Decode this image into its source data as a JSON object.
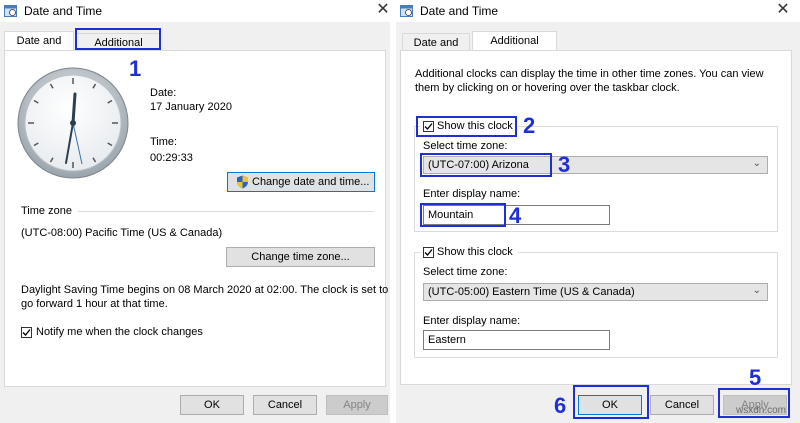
{
  "left_window": {
    "title": "Date and Time",
    "tabs": [
      {
        "label": "Date and Time"
      },
      {
        "label": "Additional Clocks"
      }
    ],
    "date_label": "Date:",
    "date_value": "17 January 2020",
    "time_label": "Time:",
    "time_value": "00:29:33",
    "change_datetime_button": "Change date and time...",
    "timezone_section": "Time zone",
    "timezone_value": "(UTC-08:00) Pacific Time (US & Canada)",
    "change_timezone_button": "Change time zone...",
    "dst_text_line1": "Daylight Saving Time begins on 08 March 2020 at 02:00. The clock is set to",
    "dst_text_line2": "go forward 1 hour at that time.",
    "notify_checkbox_label": "Notify me when the clock changes",
    "notify_checked": true,
    "ok_button": "OK",
    "cancel_button": "Cancel",
    "apply_button": "Apply"
  },
  "right_window": {
    "title": "Date and Time",
    "tabs": [
      {
        "label": "Date and Time"
      },
      {
        "label": "Additional Clocks"
      }
    ],
    "intro_line1": "Additional clocks can display the time in other time zones. You can view",
    "intro_line2": "them by clicking on or hovering over the taskbar clock.",
    "clock1": {
      "show_label": "Show this clock",
      "checked": true,
      "select_label": "Select time zone:",
      "timezone": "(UTC-07:00) Arizona",
      "display_name_label": "Enter display name:",
      "display_name": "Mountain"
    },
    "clock2": {
      "show_label": "Show this clock",
      "checked": true,
      "select_label": "Select time zone:",
      "timezone": "(UTC-05:00) Eastern Time (US & Canada)",
      "display_name_label": "Enter display name:",
      "display_name": "Eastern"
    },
    "ok_button": "OK",
    "cancel_button": "Cancel",
    "apply_button": "Apply"
  },
  "annotations": [
    "1",
    "2",
    "3",
    "4",
    "5",
    "6"
  ],
  "watermark": "wsxdn.com",
  "colors": {
    "highlight": "#1f2fd6",
    "window_bg": "#f0f0f0",
    "accent": "#0078d7"
  },
  "icons": [
    "date-time-app-icon",
    "close-icon",
    "analog-clock-icon",
    "uac-shield-icon",
    "chevron-down-icon",
    "checkmark-icon"
  ]
}
